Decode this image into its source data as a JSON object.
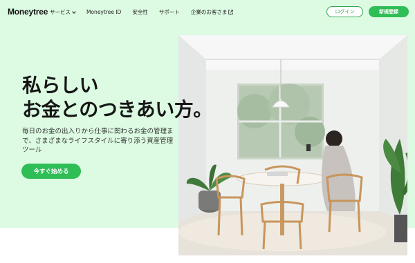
{
  "header": {
    "logo": "Moneytree",
    "nav": [
      {
        "label": "サービス",
        "has_dropdown": true
      },
      {
        "label": "Moneytree ID"
      },
      {
        "label": "安全性"
      },
      {
        "label": "サポート"
      },
      {
        "label": "企業のお客さま",
        "external": true
      }
    ],
    "login_label": "ログイン",
    "signup_label": "新規登録"
  },
  "hero": {
    "headline_line1": "私らしい",
    "headline_line2": "お金とのつきあい方。",
    "description": "毎日のお金の出入りから仕事に関わるお金の管理まで、さまざまなライフスタイルに寄り添う資産管理ツール",
    "cta_label": "今すぐ始める"
  },
  "colors": {
    "hero_background": "#dcfbe2",
    "brand_green": "#2fbd56",
    "text_dark": "#161616"
  }
}
